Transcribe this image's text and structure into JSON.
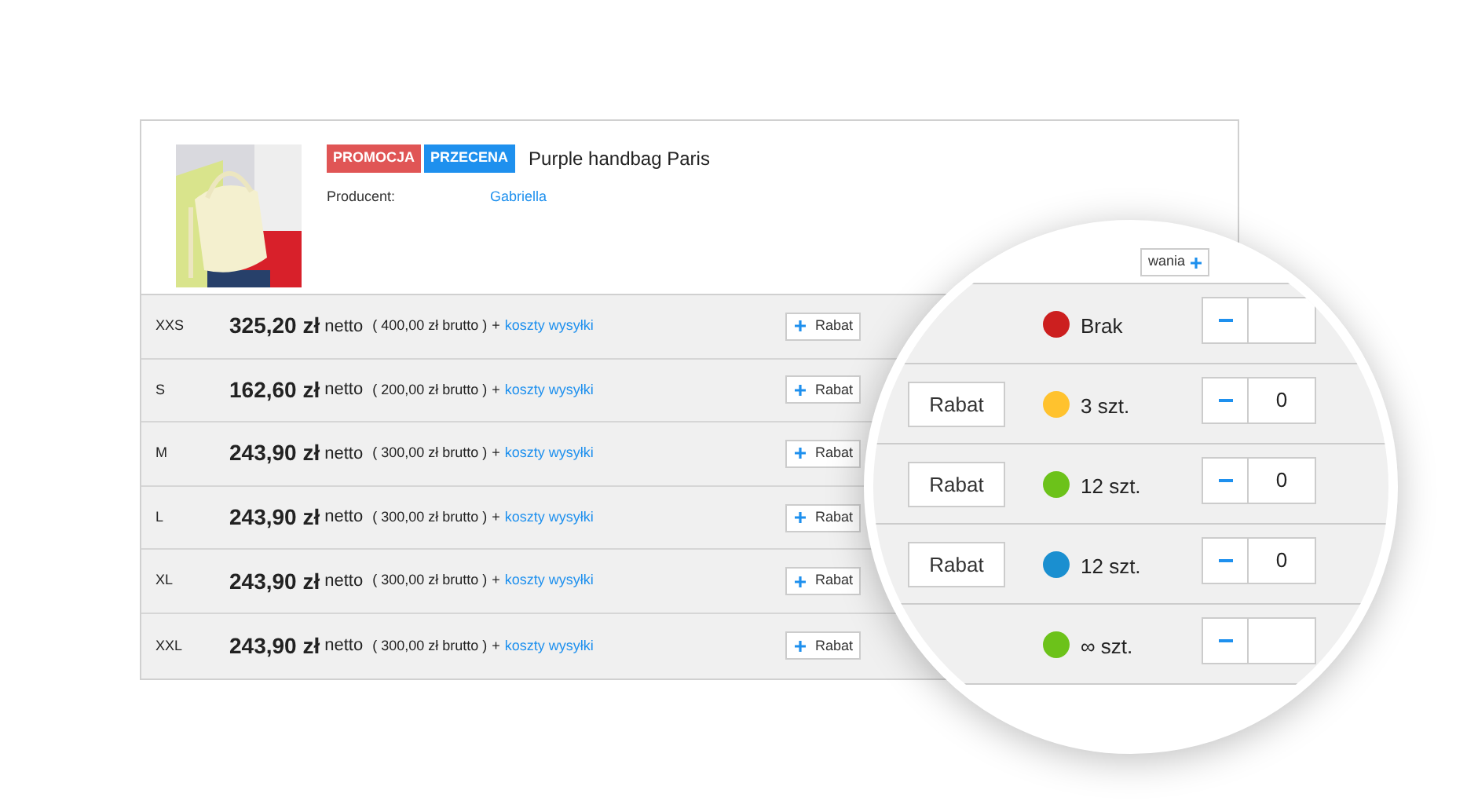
{
  "product": {
    "badges": [
      {
        "label": "PROMOCJA",
        "color": "#e05555"
      },
      {
        "label": "PRZECENA",
        "color": "#1e90ee"
      }
    ],
    "title": "Purple handbag Paris",
    "producer_label": "Producent:",
    "producer": "Gabriella"
  },
  "rows": [
    {
      "size": "XXS",
      "price": "325,20 zł",
      "net": "netto",
      "gross": "( 400,00 zł brutto )",
      "plus": "+",
      "shipping": "koszty wysyłki",
      "discount": "Rabat"
    },
    {
      "size": "S",
      "price": "162,60 zł",
      "net": "netto",
      "gross": "( 200,00 zł brutto )",
      "plus": "+",
      "shipping": "koszty wysyłki",
      "discount": "Rabat"
    },
    {
      "size": "M",
      "price": "243,90 zł",
      "net": "netto",
      "gross": "( 300,00 zł brutto )",
      "plus": "+",
      "shipping": "koszty wysyłki",
      "discount": "Rabat"
    },
    {
      "size": "L",
      "price": "243,90 zł",
      "net": "netto",
      "gross": "( 300,00 zł brutto )",
      "plus": "+",
      "shipping": "koszty wysyłki",
      "discount": "Rabat"
    },
    {
      "size": "XL",
      "price": "243,90 zł",
      "net": "netto",
      "gross": "( 300,00 zł brutto )",
      "plus": "+",
      "shipping": "koszty wysyłki",
      "discount": "Rabat"
    },
    {
      "size": "XXL",
      "price": "243,90 zł",
      "net": "netto",
      "gross": "( 300,00 zł brutto )",
      "plus": "+",
      "shipping": "koszty wysyłki",
      "discount": "Rabat"
    }
  ],
  "magnifier": {
    "top_button": "wania",
    "rows": [
      {
        "stock": "Brak",
        "color": "#cc1f1f"
      },
      {
        "discount": "Rabat",
        "stock": "3 szt.",
        "color": "#ffc22e",
        "quantity": "0"
      },
      {
        "discount": "Rabat",
        "stock": "12 szt.",
        "color": "#6cc21a",
        "quantity": "0"
      },
      {
        "discount": "Rabat",
        "stock": "12 szt.",
        "color": "#1a8fd0",
        "quantity": "0"
      },
      {
        "stock": "∞ szt.",
        "color": "#6cc21a"
      }
    ]
  }
}
